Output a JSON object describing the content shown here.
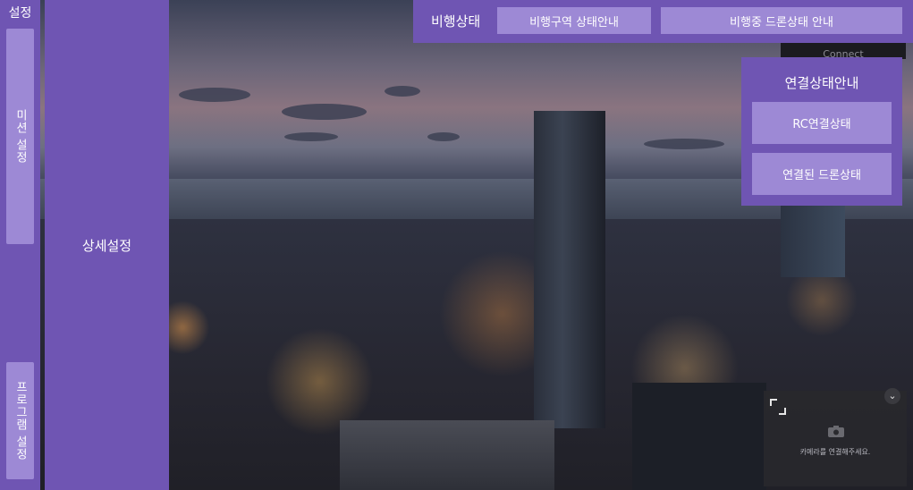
{
  "sidebar": {
    "title": "설정",
    "mission_button": "미션 설정",
    "program_button": "프로그램 설정"
  },
  "detail_panel": {
    "title": "상세설정"
  },
  "flight_status": {
    "title": "비행상태",
    "zone_button": "비행구역 상태안내",
    "drone_button": "비행중 드론상태 안내"
  },
  "connect_tab": {
    "label": "Connect"
  },
  "connection_panel": {
    "title": "연결상태안내",
    "rc_button": "RC연결상태",
    "drone_button": "연결된 드론상태"
  },
  "camera": {
    "message": "카메라를 연결해주세요.",
    "icons": [
      "expand-icon",
      "chevron-down-icon",
      "camera-icon"
    ]
  },
  "colors": {
    "panel": "#6f55b3",
    "button": "#9d89d5",
    "text": "#ffffff"
  }
}
